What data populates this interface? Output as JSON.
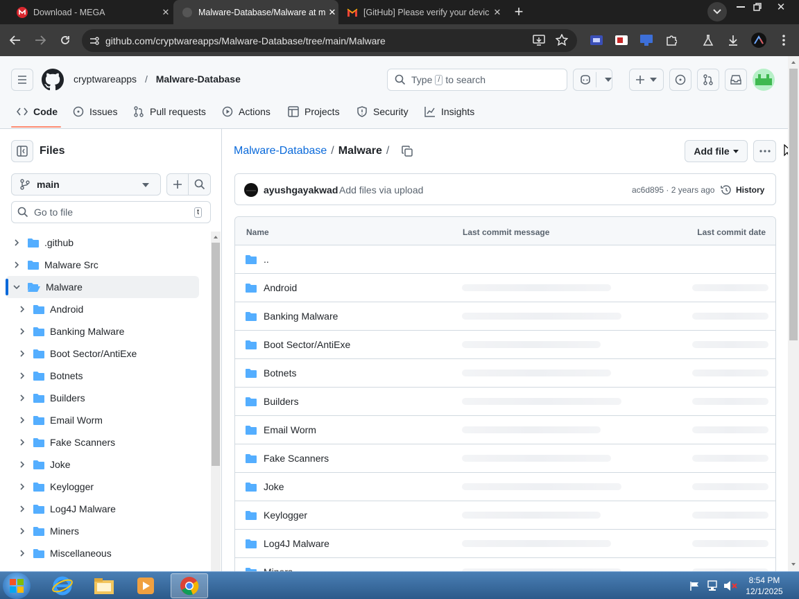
{
  "browser": {
    "tabs": [
      {
        "title": "Download - MEGA"
      },
      {
        "title": "Malware-Database/Malware at m"
      },
      {
        "title": "[GitHub] Please verify your devic"
      }
    ],
    "url": "github.com/cryptwareapps/Malware-Database/tree/main/Malware"
  },
  "github": {
    "owner": "cryptwareapps",
    "separator": "/",
    "repo": "Malware-Database",
    "search": {
      "prefix": "Type",
      "key": "/",
      "suffix": "to search"
    },
    "repo_tabs": [
      "Code",
      "Issues",
      "Pull requests",
      "Actions",
      "Projects",
      "Security",
      "Insights"
    ]
  },
  "sidebar": {
    "title": "Files",
    "branch": "main",
    "goto_placeholder": "Go to file",
    "goto_key": "t",
    "tree": [
      {
        "label": ".github",
        "depth": 0,
        "expanded": false
      },
      {
        "label": "Malware Src",
        "depth": 0,
        "expanded": false
      },
      {
        "label": "Malware",
        "depth": 0,
        "expanded": true
      },
      {
        "label": "Android",
        "depth": 1,
        "expanded": false
      },
      {
        "label": "Banking Malware",
        "depth": 1,
        "expanded": false
      },
      {
        "label": "Boot Sector/AntiExe",
        "depth": 1,
        "expanded": false
      },
      {
        "label": "Botnets",
        "depth": 1,
        "expanded": false
      },
      {
        "label": "Builders",
        "depth": 1,
        "expanded": false
      },
      {
        "label": "Email Worm",
        "depth": 1,
        "expanded": false
      },
      {
        "label": "Fake Scanners",
        "depth": 1,
        "expanded": false
      },
      {
        "label": "Joke",
        "depth": 1,
        "expanded": false
      },
      {
        "label": "Keylogger",
        "depth": 1,
        "expanded": false
      },
      {
        "label": "Log4J Malware",
        "depth": 1,
        "expanded": false
      },
      {
        "label": "Miners",
        "depth": 1,
        "expanded": false
      },
      {
        "label": "Miscellaneous",
        "depth": 1,
        "expanded": false
      }
    ]
  },
  "main": {
    "breadcrumb_repo": "Malware-Database",
    "breadcrumb_sep1": "/",
    "breadcrumb_folder": "Malware",
    "breadcrumb_sep2": "/",
    "add_file": "Add file",
    "commit": {
      "author": "ayushgayakwad",
      "message": "Add files via upload",
      "hash": "ac6d895",
      "time": "2 years ago",
      "history": "History"
    },
    "table_headers": {
      "name": "Name",
      "message": "Last commit message",
      "date": "Last commit date"
    },
    "parent_dir": "..",
    "rows": [
      "Android",
      "Banking Malware",
      "Boot Sector/AntiExe",
      "Botnets",
      "Builders",
      "Email Worm",
      "Fake Scanners",
      "Joke",
      "Keylogger",
      "Log4J Malware",
      "Miners"
    ]
  },
  "taskbar": {
    "time": "8:54 PM",
    "date": "12/1/2025"
  },
  "colors": {
    "accent": "#0969da",
    "folder": "#54aeff",
    "tab_underline": "#fd8c73"
  }
}
